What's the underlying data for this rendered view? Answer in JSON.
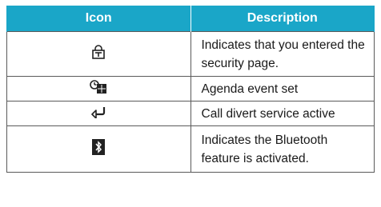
{
  "table": {
    "header": {
      "icon": "Icon",
      "description": "Description"
    },
    "rows": [
      {
        "icon": "security-lock-icon",
        "description": "Indicates that you entered the security page."
      },
      {
        "icon": "agenda-event-icon",
        "description": "Agenda event set"
      },
      {
        "icon": "call-divert-icon",
        "description": "Call divert service active"
      },
      {
        "icon": "bluetooth-icon",
        "description": "Indicates the Bluetooth feature is activated."
      }
    ]
  },
  "colors": {
    "header_bg": "#1aa6c8",
    "header_text": "#ffffff",
    "border": "#5a5a5a"
  }
}
